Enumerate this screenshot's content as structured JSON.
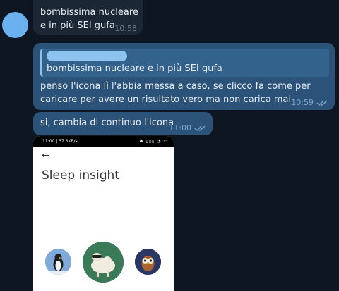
{
  "messages": {
    "incoming": {
      "text": "bombissima nucleare e in più SEI gufa",
      "time": "10:58"
    },
    "outgoing_reply": {
      "quote_text": "bombissima nucleare e in più SEI gufa",
      "text": "penso l'icona lì l'abbia messa a caso, se clicco fa come per caricare per avere un risultato vero ma non carica mai",
      "time": "10:59"
    },
    "outgoing_short": {
      "text": "si, cambia di continuo l'icona",
      "time": "11:00"
    }
  },
  "screenshot": {
    "status_left": "11:00 | 37.3KB/s",
    "status_right": "✱ ▯▯▯ ◔ ▭",
    "back_icon": "←",
    "title": "Sleep insight"
  },
  "colors": {
    "background": "#0e1621",
    "outgoing_bubble": "#2b5278",
    "incoming_bubble": "#1b2734",
    "read_check": "#7fa8cc"
  }
}
